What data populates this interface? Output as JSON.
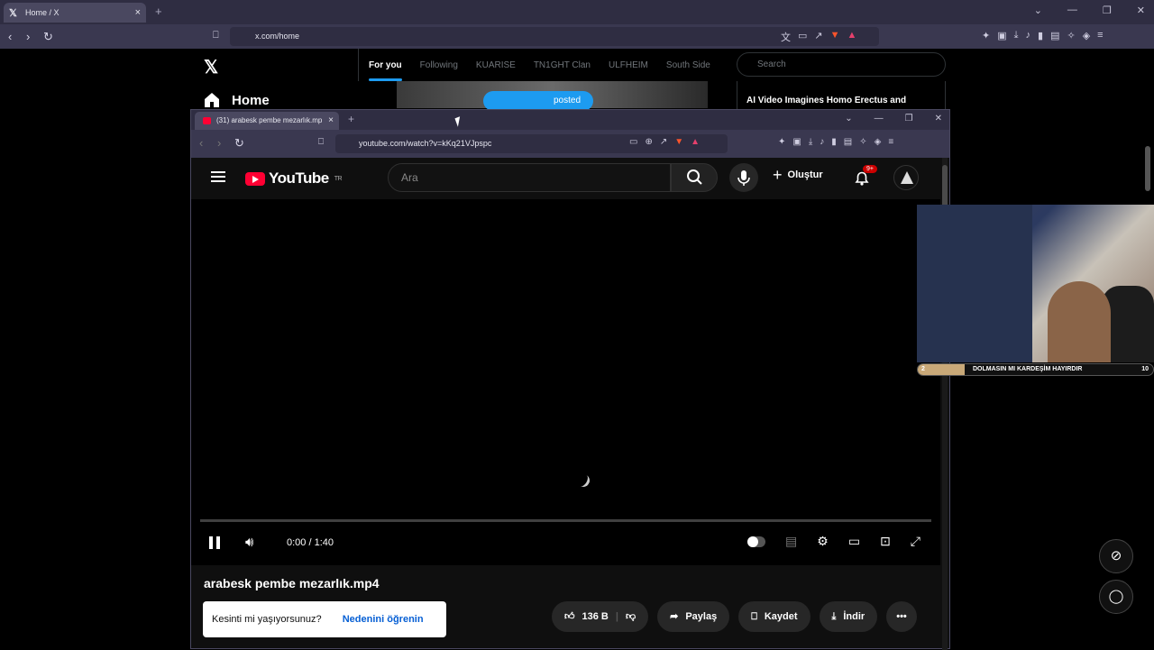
{
  "outer": {
    "tab_title": "Home / X",
    "url": "x.com/home"
  },
  "x": {
    "nav_home": "Home",
    "tabs": [
      "For you",
      "Following",
      "KUARISE",
      "TN1GHT Clan",
      "ULFHEIM",
      "South Side"
    ],
    "search_placeholder": "Search",
    "posted_label": "posted",
    "trend_text": "AI Video Imagines Homo Erectus and"
  },
  "inner": {
    "tab_title": "(31) arabesk pembe mezarlık.mp",
    "url": "youtube.com/watch?v=kKq21VJpspc"
  },
  "youtube": {
    "logo_text": "YouTube",
    "region": "TR",
    "search_placeholder": "Ara",
    "create_label": "Oluştur",
    "notifications": "9+",
    "time": "0:00 / 1:40",
    "progress": 0,
    "video_title": "arabesk pembe mezarlık.mp4",
    "toast_text": "Kesinti mi yaşıyorsunuz?",
    "toast_link": "Nedenini öğrenin",
    "likes": "136 B",
    "share_label": "Paylaş",
    "save_label": "Kaydet",
    "download_label": "İndir"
  },
  "webcam_bar": {
    "left_value": "2",
    "caption": "DOLMASIN MI KARDEŞİM HAYIRDIR",
    "right_value": "10"
  },
  "colors": {
    "brave_toolbar": "#3a3850",
    "youtube_red": "#ff0033",
    "x_blue": "#1d9bf0",
    "link_blue": "#065fd4"
  }
}
